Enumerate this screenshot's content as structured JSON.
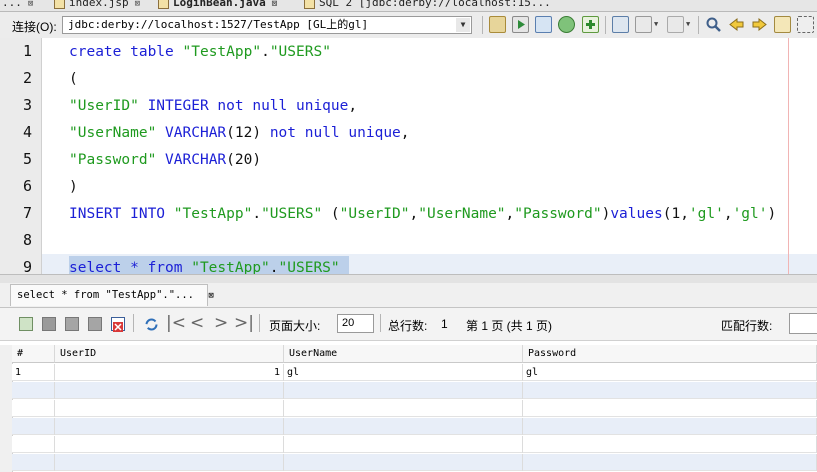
{
  "file_tabs": [
    {
      "label": "...",
      "close": "⊠"
    },
    {
      "label": "index.jsp",
      "close": "⊠"
    },
    {
      "label": "LoginBean.java",
      "close": "⊠"
    },
    {
      "label": "SQL 2 [jdbc:derby://localhost:15...",
      "close": ""
    }
  ],
  "connection": {
    "label": "连接(O):",
    "value": "jdbc:derby://localhost:1527/TestApp [GL上的gl]"
  },
  "toolbar_icons": [
    "run-sql-icon",
    "run-statement-icon",
    "history-icon",
    "refresh-icon",
    "add-icon",
    "back-icon",
    "options-icon",
    "explain-icon",
    "search-icon",
    "prev-occurrence-icon",
    "next-occurrence-icon",
    "toggle-bookmark-icon",
    "next-bookmark-icon"
  ],
  "editor": {
    "lines": [
      {
        "n": "1",
        "tokens": [
          [
            "k",
            "create table "
          ],
          [
            "s",
            "\"TestApp\""
          ],
          [
            "p",
            "."
          ],
          [
            "s",
            "\"USERS\""
          ]
        ]
      },
      {
        "n": "2",
        "tokens": [
          [
            "p",
            "("
          ]
        ]
      },
      {
        "n": "3",
        "tokens": [
          [
            "s",
            "\"UserID\""
          ],
          [
            "p",
            " "
          ],
          [
            "k",
            "INTEGER not null unique"
          ],
          [
            "p",
            ","
          ]
        ]
      },
      {
        "n": "4",
        "tokens": [
          [
            "s",
            "\"UserName\""
          ],
          [
            "p",
            " "
          ],
          [
            "k",
            "VARCHAR"
          ],
          [
            "p",
            "("
          ],
          [
            "n",
            "12"
          ],
          [
            "p",
            ") "
          ],
          [
            "k",
            "not null unique"
          ],
          [
            "p",
            ","
          ]
        ]
      },
      {
        "n": "5",
        "tokens": [
          [
            "s",
            "\"Password\""
          ],
          [
            "p",
            " "
          ],
          [
            "k",
            "VARCHAR"
          ],
          [
            "p",
            "("
          ],
          [
            "n",
            "20"
          ],
          [
            "p",
            ")"
          ]
        ]
      },
      {
        "n": "6",
        "tokens": [
          [
            "p",
            ")"
          ]
        ]
      },
      {
        "n": "7",
        "tokens": [
          [
            "k",
            "INSERT INTO "
          ],
          [
            "s",
            "\"TestApp\""
          ],
          [
            "p",
            "."
          ],
          [
            "s",
            "\"USERS\""
          ],
          [
            "p",
            " ("
          ],
          [
            "s",
            "\"UserID\""
          ],
          [
            "p",
            ","
          ],
          [
            "s",
            "\"UserName\""
          ],
          [
            "p",
            ","
          ],
          [
            "s",
            "\"Password\""
          ],
          [
            "p",
            ")"
          ],
          [
            "k",
            "values"
          ],
          [
            "p",
            "("
          ],
          [
            "n",
            "1"
          ],
          [
            "p",
            ","
          ],
          [
            "s",
            "'gl'"
          ],
          [
            "p",
            ","
          ],
          [
            "s",
            "'gl'"
          ],
          [
            "p",
            ")"
          ]
        ]
      },
      {
        "n": "8",
        "tokens": []
      },
      {
        "n": "9",
        "tokens": [
          [
            "k",
            "select * from "
          ],
          [
            "s",
            "\"TestApp\""
          ],
          [
            "p",
            "."
          ],
          [
            "s",
            "\"USERS\""
          ]
        ]
      }
    ]
  },
  "result_tab": {
    "label": "select * from \"TestApp\".\"...",
    "close": "⊠"
  },
  "result_toolbar": {
    "page_size_label": "页面大小:",
    "page_size_value": "20",
    "total_rows_label": "总行数:",
    "total_rows_value": "1",
    "page_info": "第 1 页 (共 1 页)",
    "match_count_label": "匹配行数:"
  },
  "grid": {
    "columns": [
      "#",
      "UserID",
      "UserName",
      "Password"
    ],
    "rows": [
      [
        "1",
        "1",
        "gl",
        "gl"
      ]
    ],
    "empty_rows": 5
  }
}
